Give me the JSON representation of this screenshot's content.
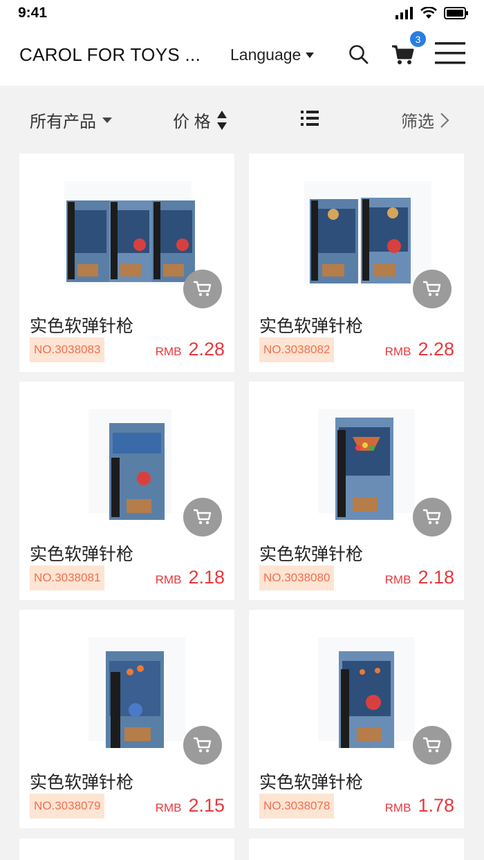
{
  "status_bar": {
    "time": "9:41"
  },
  "header": {
    "brand": "CAROL FOR TOYS ...",
    "language_label": "Language",
    "cart_count": "3"
  },
  "filter_bar": {
    "all_products": "所有产品",
    "price": "价 格",
    "filter": "筛选"
  },
  "colors": {
    "price": "#e8383d",
    "badge": "#2a7de1",
    "tag_bg": "#fde4d3",
    "tag_text": "#f07050"
  },
  "products": [
    {
      "name": "实色软弹针枪",
      "no": "NO.3038083",
      "currency": "RMB",
      "price": "2.28"
    },
    {
      "name": "实色软弹针枪",
      "no": "NO.3038082",
      "currency": "RMB",
      "price": "2.28"
    },
    {
      "name": "实色软弹针枪",
      "no": "NO.3038081",
      "currency": "RMB",
      "price": "2.18"
    },
    {
      "name": "实色软弹针枪",
      "no": "NO.3038080",
      "currency": "RMB",
      "price": "2.18"
    },
    {
      "name": "实色软弹针枪",
      "no": "NO.3038079",
      "currency": "RMB",
      "price": "2.15"
    },
    {
      "name": "实色软弹针枪",
      "no": "NO.3038078",
      "currency": "RMB",
      "price": "1.78"
    }
  ]
}
